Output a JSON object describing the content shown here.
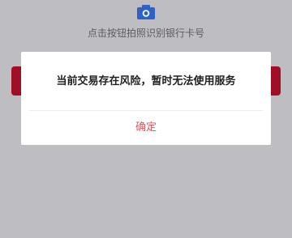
{
  "page": {
    "camera_icon": "camera-icon",
    "hint": "点击按钮拍照识别银行卡号"
  },
  "dialog": {
    "message": "当前交易存在风险，暂时无法使用服务",
    "confirm_label": "确定"
  },
  "colors": {
    "background": "#bebdc2",
    "icon": "#2f62c6",
    "button_red": "#a10e27",
    "confirm_text": "#e5545f"
  }
}
